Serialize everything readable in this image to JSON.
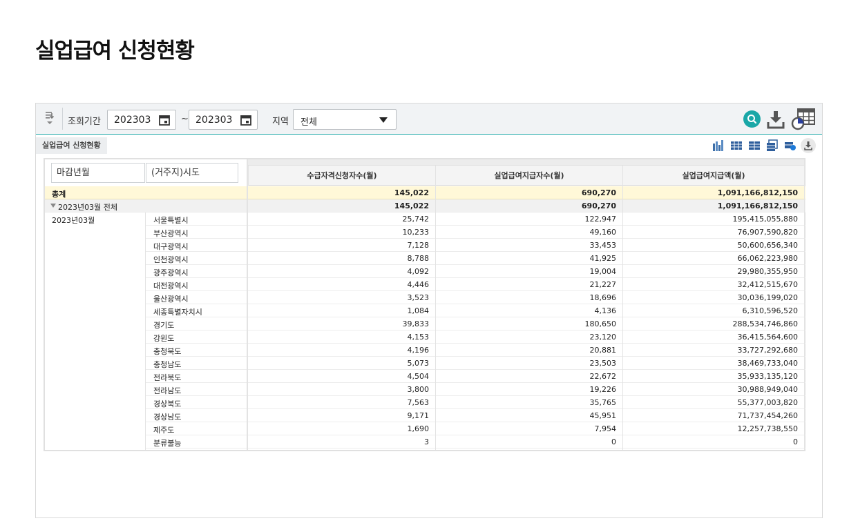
{
  "page": {
    "title": "실업급여 신청현황"
  },
  "toolbar": {
    "period_label": "조회기간",
    "start_date": "202303",
    "tilde": "~",
    "end_date": "202303",
    "region_label": "지역",
    "region_value": "전체",
    "icons": {
      "collapse": "collapse-toggle-icon",
      "calendar": "calendar-icon",
      "dropdown": "chevron-down-icon",
      "search": "search-icon",
      "download": "download-icon",
      "grid_settings": "table-settings-icon"
    },
    "accent_color": "#1aa7a7"
  },
  "subheader": {
    "tab_label": "실업급여 신청현황",
    "tool_icons": [
      "column-chart-icon",
      "grid-view-icon",
      "grid-expand-icon",
      "copy-grid-icon",
      "grid-filter-icon",
      "download-icon"
    ]
  },
  "grid": {
    "pivot_fields": [
      "마감년월",
      "(거주지)시도"
    ],
    "columns": [
      "수급자격신청자수(월)",
      "실업급여지급자수(월)",
      "실업급여지급액(월)"
    ],
    "total": {
      "label": "총계",
      "values": [
        "145,022",
        "690,270",
        "1,091,166,812,150"
      ]
    },
    "subtotal": {
      "label": "2023년03월 전체",
      "values": [
        "145,022",
        "690,270",
        "1,091,166,812,150"
      ]
    },
    "group_label": "2023년03월",
    "rows": [
      {
        "region": "서울특별시",
        "values": [
          "25,742",
          "122,947",
          "195,415,055,880"
        ]
      },
      {
        "region": "부산광역시",
        "values": [
          "10,233",
          "49,160",
          "76,907,590,820"
        ]
      },
      {
        "region": "대구광역시",
        "values": [
          "7,128",
          "33,453",
          "50,600,656,340"
        ]
      },
      {
        "region": "인천광역시",
        "values": [
          "8,788",
          "41,925",
          "66,062,223,980"
        ]
      },
      {
        "region": "광주광역시",
        "values": [
          "4,092",
          "19,004",
          "29,980,355,950"
        ]
      },
      {
        "region": "대전광역시",
        "values": [
          "4,446",
          "21,227",
          "32,412,515,670"
        ]
      },
      {
        "region": "울산광역시",
        "values": [
          "3,523",
          "18,696",
          "30,036,199,020"
        ]
      },
      {
        "region": "세종특별자치시",
        "values": [
          "1,084",
          "4,136",
          "6,310,596,520"
        ]
      },
      {
        "region": "경기도",
        "values": [
          "39,833",
          "180,650",
          "288,534,746,860"
        ]
      },
      {
        "region": "강원도",
        "values": [
          "4,153",
          "23,120",
          "36,415,564,600"
        ]
      },
      {
        "region": "충청북도",
        "values": [
          "4,196",
          "20,881",
          "33,727,292,680"
        ]
      },
      {
        "region": "충청남도",
        "values": [
          "5,073",
          "23,503",
          "38,469,733,040"
        ]
      },
      {
        "region": "전라북도",
        "values": [
          "4,504",
          "22,672",
          "35,933,135,120"
        ]
      },
      {
        "region": "전라남도",
        "values": [
          "3,800",
          "19,226",
          "30,988,949,040"
        ]
      },
      {
        "region": "경상북도",
        "values": [
          "7,563",
          "35,765",
          "55,377,003,820"
        ]
      },
      {
        "region": "경상남도",
        "values": [
          "9,171",
          "45,951",
          "71,737,454,260"
        ]
      },
      {
        "region": "제주도",
        "values": [
          "1,690",
          "7,954",
          "12,257,738,550"
        ]
      },
      {
        "region": "분류불능",
        "values": [
          "3",
          "0",
          "0"
        ]
      }
    ]
  }
}
